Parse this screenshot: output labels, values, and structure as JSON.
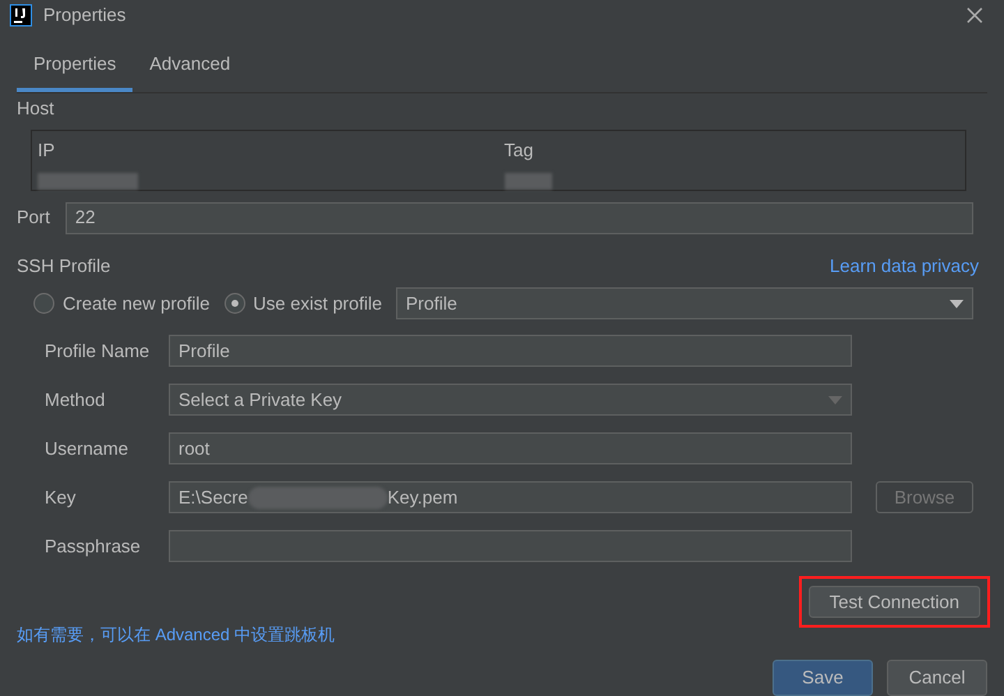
{
  "window": {
    "title": "Properties"
  },
  "tabs": [
    {
      "label": "Properties",
      "selected": true
    },
    {
      "label": "Advanced",
      "selected": false
    }
  ],
  "host": {
    "label": "Host",
    "columns": [
      "IP",
      "Tag"
    ]
  },
  "port": {
    "label": "Port",
    "value": "22"
  },
  "ssh_profile": {
    "label": "SSH Profile",
    "link": "Learn data privacy",
    "options": [
      {
        "label": "Create new profile",
        "selected": false
      },
      {
        "label": "Use exist profile",
        "selected": true
      }
    ],
    "profile_select": "Profile"
  },
  "form": [
    {
      "kind": "text",
      "label": "Profile Name",
      "value": "Profile"
    },
    {
      "kind": "select",
      "label": "Method",
      "value": "Select a Private Key"
    },
    {
      "kind": "text",
      "label": "Username",
      "value": "root"
    },
    {
      "kind": "file",
      "label": "Key",
      "value_start": "E:\\Secre",
      "value_end": "Key.pem",
      "button": "Browse",
      "button_disabled": true
    },
    {
      "kind": "text",
      "label": "Passphrase"
    }
  ],
  "test_button": "Test Connection",
  "hint": "如有需要，可以在 Advanced 中设置跳板机",
  "buttons": [
    {
      "label": "Save",
      "kind": "primary"
    },
    {
      "label": "Cancel",
      "kind": "secondary"
    }
  ]
}
